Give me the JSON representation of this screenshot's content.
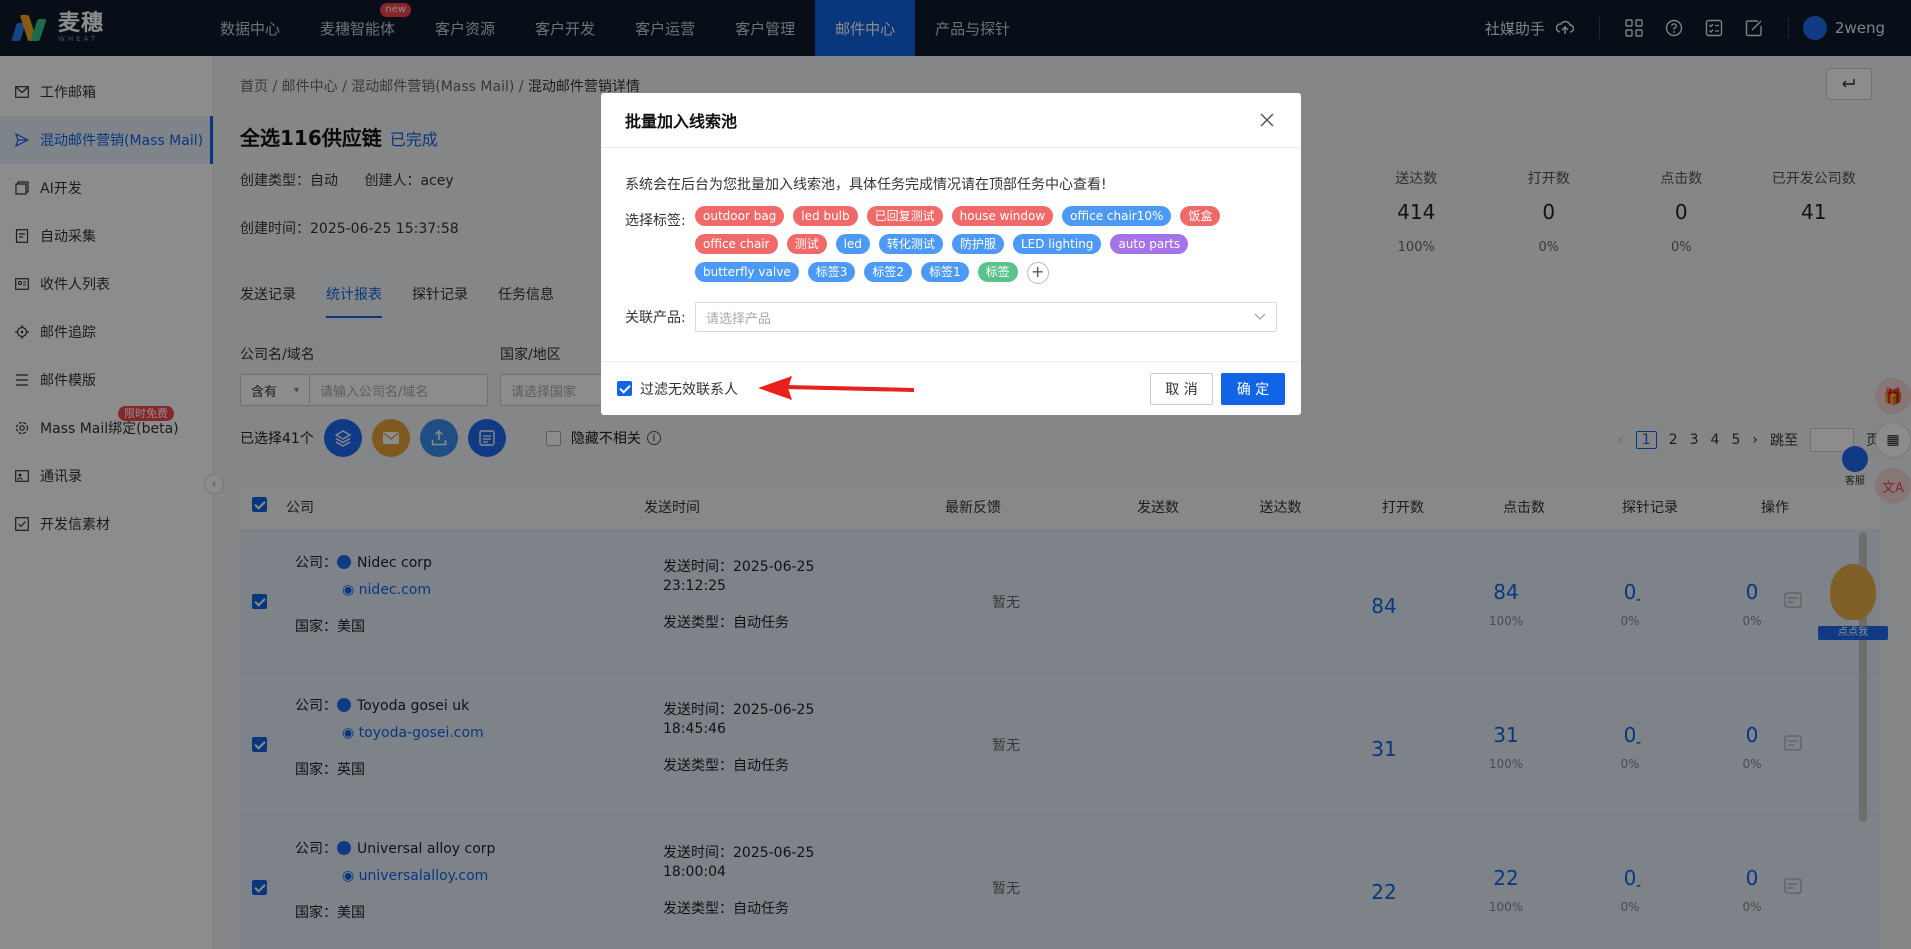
{
  "brand": {
    "name": "麦穗",
    "sub": "WHEAT"
  },
  "nav": [
    {
      "label": "数据中心"
    },
    {
      "label": "麦穗智能体",
      "badge": "new"
    },
    {
      "label": "客户资源"
    },
    {
      "label": "客户开发"
    },
    {
      "label": "客户运营"
    },
    {
      "label": "客户管理"
    },
    {
      "label": "邮件中心",
      "active": true
    },
    {
      "label": "产品与探针"
    }
  ],
  "topright": {
    "helper": "社媒助手",
    "user": "2weng"
  },
  "sidebar": [
    {
      "label": "工作邮箱",
      "icon": "mail-icon"
    },
    {
      "label": "混动邮件营销(Mass Mail)",
      "icon": "send-icon",
      "active": true
    },
    {
      "label": "AI开发",
      "icon": "ai-icon"
    },
    {
      "label": "自动采集",
      "icon": "collect-icon"
    },
    {
      "label": "收件人列表",
      "icon": "recipient-icon"
    },
    {
      "label": "邮件追踪",
      "icon": "track-icon"
    },
    {
      "label": "邮件模版",
      "icon": "template-icon"
    },
    {
      "label": "Mass Mail绑定(beta)",
      "icon": "bind-icon",
      "badge": "限时免费"
    },
    {
      "label": "通讯录",
      "icon": "contacts-icon"
    },
    {
      "label": "开发信素材",
      "icon": "material-icon"
    }
  ],
  "breadcrumb": [
    "首页",
    "邮件中心",
    "混动邮件营销(Mass Mail)",
    "混动邮件营销详情"
  ],
  "page": {
    "title": "全选116供应链",
    "status": "已完成",
    "create_type_label": "创建类型：",
    "create_type": "自动",
    "creator_label": "创建人：",
    "creator": "acey",
    "created_label": "创建时间：",
    "created": "2025-06-25 15:37:58"
  },
  "stats": [
    {
      "label": "送达数",
      "value": "414",
      "pct": "100%"
    },
    {
      "label": "打开数",
      "value": "0",
      "pct": "0%"
    },
    {
      "label": "点击数",
      "value": "0",
      "pct": "0%"
    },
    {
      "label": "已开发公司数",
      "value": "41",
      "pct": ""
    }
  ],
  "tabs": [
    "发送记录",
    "统计报表",
    "探针记录",
    "任务信息"
  ],
  "filters": {
    "company_label": "公司名/域名",
    "contains": "含有",
    "company_placeholder": "请输入公司名/域名",
    "country_label": "国家/地区",
    "country_placeholder": "请选择国家"
  },
  "toolbar": {
    "selected": "已选择41个",
    "hide_label": "隐藏不相关"
  },
  "pager": {
    "pages": [
      "1",
      "2",
      "3",
      "4",
      "5"
    ],
    "jump": "跳至",
    "page_suffix": "页"
  },
  "table": {
    "headers": [
      "公司",
      "发送时间",
      "最新反馈",
      "发送数",
      "送达数",
      "打开数",
      "点击数",
      "探针记录",
      "操作"
    ],
    "company_label": "公司：",
    "country_label": "国家：",
    "send_time_label": "发送时间：",
    "send_type_label": "发送类型：",
    "rows": [
      {
        "company": "Nidec corp",
        "domain": "nidec.com",
        "country": "美国",
        "send_date": "2025-06-25",
        "send_clock": "23:12:25",
        "send_type": "自动任务",
        "feedback": "暂无",
        "sent": "84",
        "delivered": "84",
        "delivered_pct": "100%",
        "opened": "0",
        "opened_pct": "0%",
        "clicked": "0",
        "clicked_pct": "0%",
        "probe": "-"
      },
      {
        "company": "Toyoda gosei uk",
        "domain": "toyoda-gosei.com",
        "country": "英国",
        "send_date": "2025-06-25",
        "send_clock": "18:45:46",
        "send_type": "自动任务",
        "feedback": "暂无",
        "sent": "31",
        "delivered": "31",
        "delivered_pct": "100%",
        "opened": "0",
        "opened_pct": "0%",
        "clicked": "0",
        "clicked_pct": "0%",
        "probe": "-"
      },
      {
        "company": "Universal alloy corp",
        "domain": "universalalloy.com",
        "country": "美国",
        "send_date": "2025-06-25",
        "send_clock": "18:00:04",
        "send_type": "自动任务",
        "feedback": "暂无",
        "sent": "22",
        "delivered": "22",
        "delivered_pct": "100%",
        "opened": "0",
        "opened_pct": "0%",
        "clicked": "0",
        "clicked_pct": "0%",
        "probe": "-"
      }
    ]
  },
  "modal": {
    "title": "批量加入线索池",
    "desc": "系统会在后台为您批量加入线索池，具体任务完成情况请在顶部任务中心查看!",
    "tags_label": "选择标签:",
    "tags": [
      {
        "text": "outdoor bag",
        "color": "#f06a6a"
      },
      {
        "text": "led bulb",
        "color": "#f06a6a"
      },
      {
        "text": "已回复测试",
        "color": "#f06a6a"
      },
      {
        "text": "house window",
        "color": "#f06a6a"
      },
      {
        "text": "office chair10%",
        "color": "#4c9af5"
      },
      {
        "text": "饭盒",
        "color": "#f06a6a"
      },
      {
        "text": "office chair",
        "color": "#f06a6a"
      },
      {
        "text": "测试",
        "color": "#f06a6a"
      },
      {
        "text": "led",
        "color": "#4c9af5"
      },
      {
        "text": "转化测试",
        "color": "#4c9af5"
      },
      {
        "text": "防护服",
        "color": "#4c9af5"
      },
      {
        "text": "LED lighting",
        "color": "#4c9af5"
      },
      {
        "text": "auto parts",
        "color": "#a474e6"
      },
      {
        "text": "butterfly valve",
        "color": "#4c9af5"
      },
      {
        "text": "标签3",
        "color": "#4c9af5"
      },
      {
        "text": "标签2",
        "color": "#4c9af5"
      },
      {
        "text": "标签1",
        "color": "#4c9af5"
      },
      {
        "text": "标签",
        "color": "#5cc28a"
      }
    ],
    "add_tag": "+",
    "product_label": "关联产品:",
    "product_placeholder": "请选择产品",
    "filter_label": "过滤无效联系人",
    "cancel": "取 消",
    "ok": "确 定"
  },
  "float": {
    "service": "客服",
    "mascot": "点点我"
  },
  "colors": {
    "primary": "#1264e6",
    "nav_bg": "#0e1a2b",
    "danger": "#f5464e"
  }
}
